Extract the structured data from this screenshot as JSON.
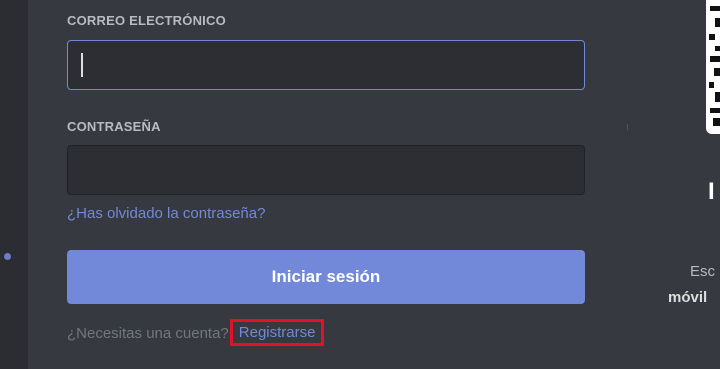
{
  "login_form": {
    "email_label": "CORREO ELECTRÓNICO",
    "email_value": "",
    "password_label": "CONTRASEÑA",
    "password_value": "",
    "forgot_password_link": "¿Has olvidado la contraseña?",
    "login_button": "Iniciar sesión",
    "need_account_text": "¿Necesitas una cuenta?",
    "register_link": "Registrarse"
  },
  "qr_panel": {
    "title": "I",
    "description_line1": "Esc",
    "description_line2": "móvil"
  },
  "colors": {
    "background": "#36393f",
    "accent": "#7289da",
    "highlight_box": "#e3102a"
  }
}
